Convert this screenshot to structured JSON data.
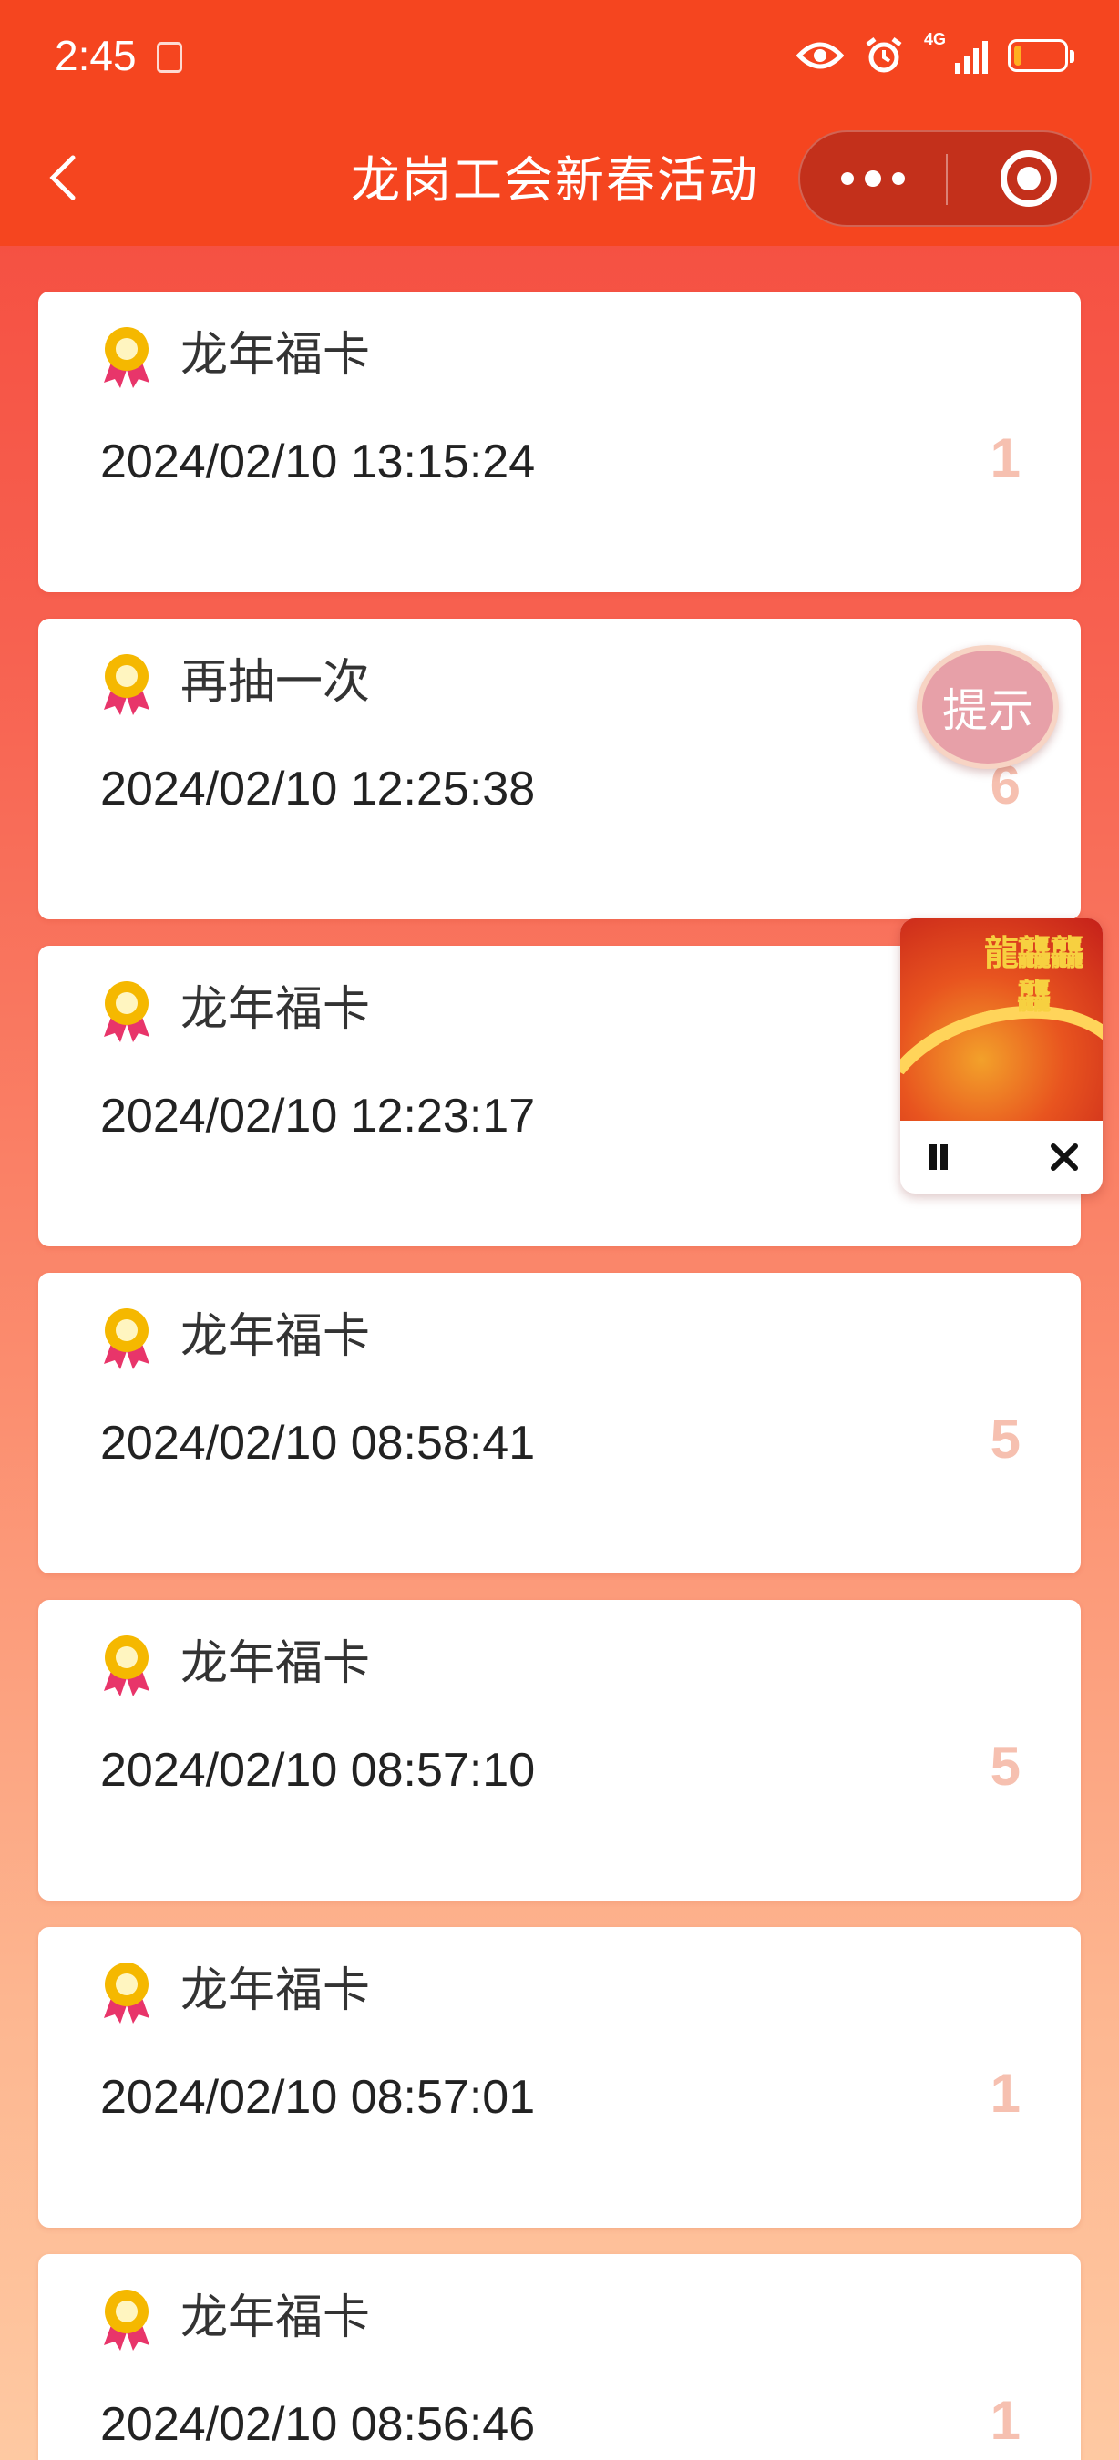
{
  "status_bar": {
    "time": "2:45",
    "network_label": "4G",
    "icons": [
      "notification-icon",
      "eye-icon",
      "alarm-icon",
      "signal-icon",
      "battery-icon"
    ],
    "battery_level": 0.15
  },
  "nav": {
    "title": "龙岗工会新春活动",
    "back_icon": "chevron-left-icon",
    "more_icon": "more-dots-icon",
    "close_icon": "target-close-icon"
  },
  "colors": {
    "header": "#f5451f",
    "count": "#f6c0b0",
    "award_gold": "#f5b800",
    "award_ribbon": "#e8356a"
  },
  "records": [
    {
      "prize": "龙年福卡",
      "time": "2024/02/10 13:15:24",
      "count": "1"
    },
    {
      "prize": "再抽一次",
      "time": "2024/02/10 12:25:38",
      "count": "6"
    },
    {
      "prize": "龙年福卡",
      "time": "2024/02/10 12:23:17",
      "count": ""
    },
    {
      "prize": "龙年福卡",
      "time": "2024/02/10 08:58:41",
      "count": "5"
    },
    {
      "prize": "龙年福卡",
      "time": "2024/02/10 08:57:10",
      "count": "5"
    },
    {
      "prize": "龙年福卡",
      "time": "2024/02/10 08:57:01",
      "count": "1"
    },
    {
      "prize": "龙年福卡",
      "time": "2024/02/10 08:56:46",
      "count": "1"
    }
  ],
  "hint_button": {
    "label": "提示"
  },
  "music_widget": {
    "art_text": "龍龘龘龘",
    "pause_icon": "pause-icon",
    "close_icon": "close-icon"
  }
}
